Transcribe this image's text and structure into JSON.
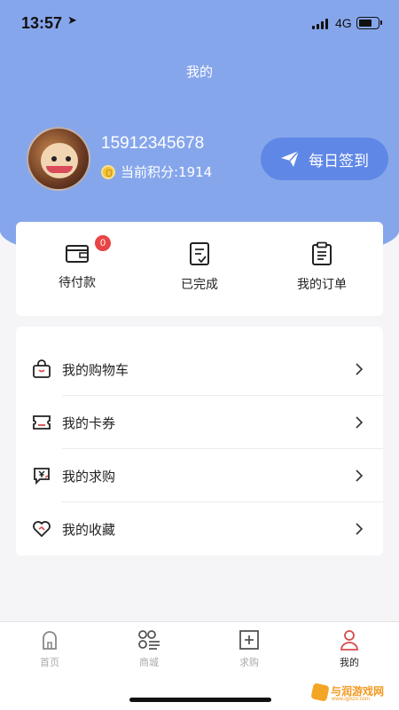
{
  "status_bar": {
    "time": "13:57",
    "network": "4G"
  },
  "header": {
    "title": "我的"
  },
  "profile": {
    "phone": "15912345678",
    "points_label": "当前积分:1914",
    "checkin_label": "每日签到"
  },
  "orders": {
    "items": [
      {
        "label": "待付款",
        "badge": "0",
        "icon": "wallet-icon"
      },
      {
        "label": "已完成",
        "icon": "completed-doc-icon"
      },
      {
        "label": "我的订单",
        "icon": "clipboard-icon"
      }
    ]
  },
  "menu": {
    "items": [
      {
        "label": "我的购物车",
        "icon": "shopping-bag-icon"
      },
      {
        "label": "我的卡券",
        "icon": "ticket-icon"
      },
      {
        "label": "我的求购",
        "icon": "yuan-bubble-icon"
      },
      {
        "label": "我的收藏",
        "icon": "heart-icon"
      }
    ]
  },
  "tabbar": {
    "items": [
      {
        "label": "首页",
        "icon": "home-icon",
        "active": false
      },
      {
        "label": "商城",
        "icon": "mall-grid-icon",
        "active": false
      },
      {
        "label": "求购",
        "icon": "plus-square-icon",
        "active": false
      },
      {
        "label": "我的",
        "icon": "person-icon",
        "active": true
      }
    ]
  },
  "watermark": {
    "text": "与润游戏网",
    "sub": "www.qpxzx.com"
  },
  "colors": {
    "header_bg": "#86a6ec",
    "checkin_bg": "#5f87e6",
    "badge": "#e84545",
    "active_icon": "#d94a4a"
  }
}
